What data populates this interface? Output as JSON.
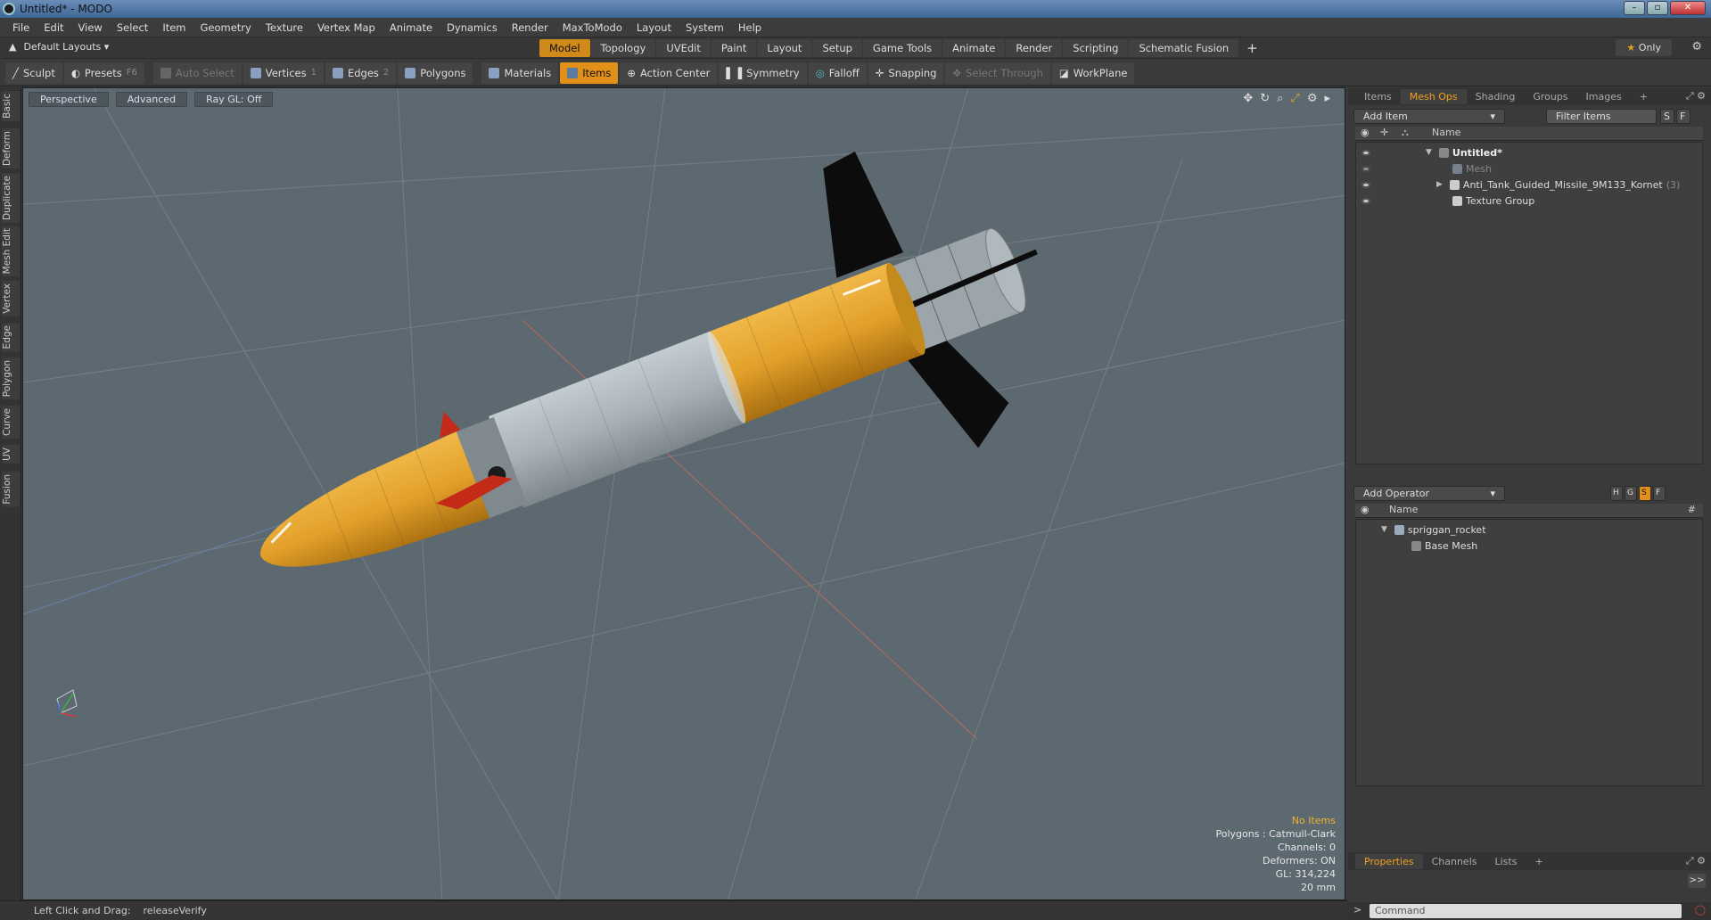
{
  "window": {
    "title": "Untitled* - MODO",
    "min": "–",
    "max": "▫",
    "close": "✕"
  },
  "menu": [
    "File",
    "Edit",
    "View",
    "Select",
    "Item",
    "Geometry",
    "Texture",
    "Vertex Map",
    "Animate",
    "Dynamics",
    "Render",
    "MaxToModo",
    "Layout",
    "System",
    "Help"
  ],
  "layoutbar": {
    "layouts_label": "Default Layouts",
    "tabs": [
      "Model",
      "Topology",
      "UVEdit",
      "Paint",
      "Layout",
      "Setup",
      "Game Tools",
      "Animate",
      "Render",
      "Scripting",
      "Schematic Fusion"
    ],
    "active_tab": "Model",
    "plus": "+",
    "only_label": "Only"
  },
  "toolbar": {
    "sculpt": "Sculpt",
    "presets": "Presets",
    "presets_key": "F6",
    "auto_select": "Auto Select",
    "vertices": "Vertices",
    "vertices_key": "1",
    "edges": "Edges",
    "edges_key": "2",
    "polygons": "Polygons",
    "materials": "Materials",
    "items": "Items",
    "action_center": "Action Center",
    "symmetry": "Symmetry",
    "falloff": "Falloff",
    "snapping": "Snapping",
    "select_through": "Select Through",
    "workplane": "WorkPlane"
  },
  "vtabs": [
    "Basic",
    "Deform",
    "Duplicate",
    "Mesh Edit",
    "Vertex",
    "Edge",
    "Polygon",
    "Curve",
    "UV",
    "Fusion"
  ],
  "viewport": {
    "view": "Perspective",
    "shading": "Advanced",
    "raygl": "Ray GL: Off",
    "info": {
      "no_items": "No Items",
      "polygons": "Polygons : Catmull-Clark",
      "channels": "Channels: 0",
      "deformers": "Deformers: ON",
      "gl": "GL: 314,224",
      "scale": "20 mm"
    }
  },
  "items_panel": {
    "tabs": [
      "Items",
      "Mesh Ops",
      "Shading",
      "Groups",
      "Images"
    ],
    "active_tab": "Mesh Ops",
    "add_item": "Add Item",
    "filter": "Filter Items",
    "s": "S",
    "f": "F",
    "col_name": "Name",
    "rows": [
      {
        "label": "Untitled*",
        "bold": true
      },
      {
        "label": "Mesh",
        "dim": true
      },
      {
        "label": "Anti_Tank_Guided_Missile_9M133_Kornet",
        "count": "(3)"
      },
      {
        "label": "Texture Group"
      }
    ]
  },
  "meshops_panel": {
    "add_operator": "Add Operator",
    "col_name": "Name",
    "col_hash": "#",
    "h": "H",
    "g": "G",
    "s": "S",
    "f": "F",
    "rows": [
      {
        "label": "spriggan_rocket"
      },
      {
        "label": "Base Mesh"
      }
    ]
  },
  "properties_panel": {
    "tabs": [
      "Properties",
      "Channels",
      "Lists"
    ],
    "active_tab": "Properties",
    "expand": ">>"
  },
  "status": {
    "hint": "Left Click and Drag:",
    "action": "releaseVerify"
  },
  "command": {
    "placeholder": "Command"
  }
}
